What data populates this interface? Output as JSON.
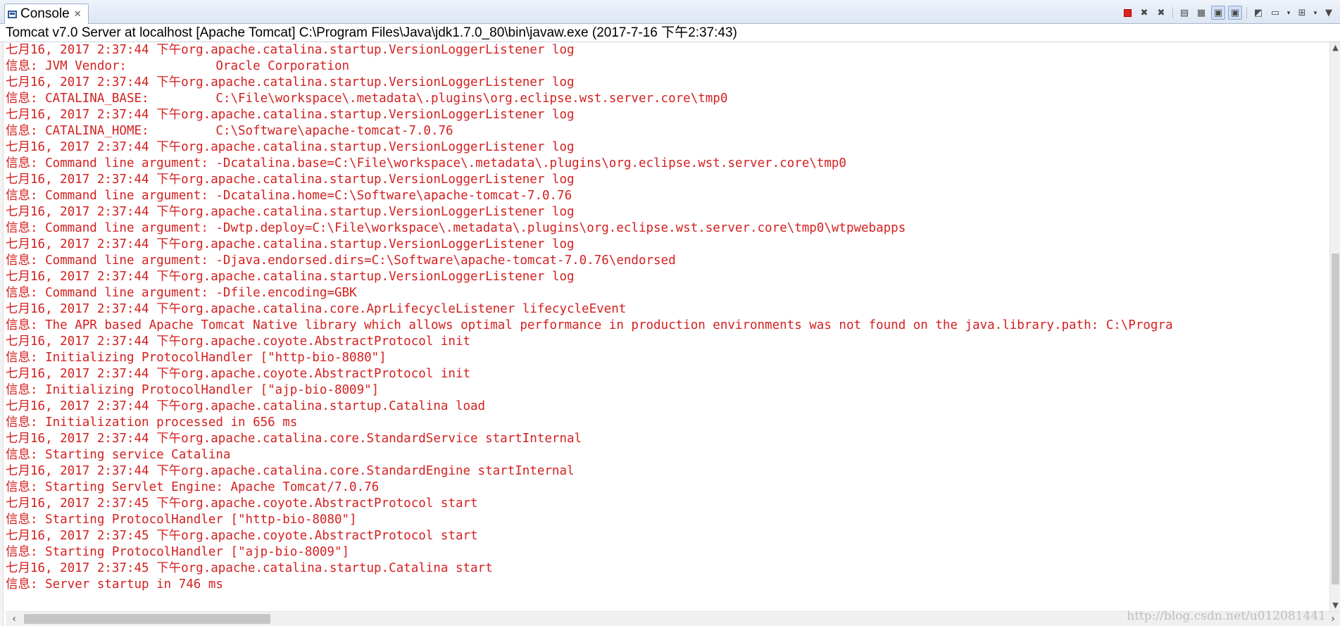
{
  "tab": {
    "title": "Console",
    "close_glyph": "✕"
  },
  "toolbar": {
    "buttons": [
      {
        "name": "terminate-icon"
      },
      {
        "name": "remove-launch-icon"
      },
      {
        "name": "remove-all-terminated-icon"
      },
      {
        "name": "clear-console-icon"
      },
      {
        "name": "scroll-lock-icon"
      },
      {
        "name": "show-stdout-icon"
      },
      {
        "name": "show-stderr-icon"
      },
      {
        "name": "pin-console-icon"
      },
      {
        "name": "display-selected-console-icon"
      },
      {
        "name": "open-console-icon"
      }
    ],
    "dropdown_glyph": "▾"
  },
  "process_label": "Tomcat v7.0 Server at localhost [Apache Tomcat] C:\\Program Files\\Java\\jdk1.7.0_80\\bin\\javaw.exe (2017-7-16 下午2:37:43)",
  "log_lines": [
    "七月16, 2017 2:37:44 下午org.apache.catalina.startup.VersionLoggerListener log",
    "信息: JVM Vendor:            Oracle Corporation",
    "七月16, 2017 2:37:44 下午org.apache.catalina.startup.VersionLoggerListener log",
    "信息: CATALINA_BASE:         C:\\File\\workspace\\.metadata\\.plugins\\org.eclipse.wst.server.core\\tmp0",
    "七月16, 2017 2:37:44 下午org.apache.catalina.startup.VersionLoggerListener log",
    "信息: CATALINA_HOME:         C:\\Software\\apache-tomcat-7.0.76",
    "七月16, 2017 2:37:44 下午org.apache.catalina.startup.VersionLoggerListener log",
    "信息: Command line argument: -Dcatalina.base=C:\\File\\workspace\\.metadata\\.plugins\\org.eclipse.wst.server.core\\tmp0",
    "七月16, 2017 2:37:44 下午org.apache.catalina.startup.VersionLoggerListener log",
    "信息: Command line argument: -Dcatalina.home=C:\\Software\\apache-tomcat-7.0.76",
    "七月16, 2017 2:37:44 下午org.apache.catalina.startup.VersionLoggerListener log",
    "信息: Command line argument: -Dwtp.deploy=C:\\File\\workspace\\.metadata\\.plugins\\org.eclipse.wst.server.core\\tmp0\\wtpwebapps",
    "七月16, 2017 2:37:44 下午org.apache.catalina.startup.VersionLoggerListener log",
    "信息: Command line argument: -Djava.endorsed.dirs=C:\\Software\\apache-tomcat-7.0.76\\endorsed",
    "七月16, 2017 2:37:44 下午org.apache.catalina.startup.VersionLoggerListener log",
    "信息: Command line argument: -Dfile.encoding=GBK",
    "七月16, 2017 2:37:44 下午org.apache.catalina.core.AprLifecycleListener lifecycleEvent",
    "信息: The APR based Apache Tomcat Native library which allows optimal performance in production environments was not found on the java.library.path: C:\\Progra",
    "七月16, 2017 2:37:44 下午org.apache.coyote.AbstractProtocol init",
    "信息: Initializing ProtocolHandler [\"http-bio-8080\"]",
    "七月16, 2017 2:37:44 下午org.apache.coyote.AbstractProtocol init",
    "信息: Initializing ProtocolHandler [\"ajp-bio-8009\"]",
    "七月16, 2017 2:37:44 下午org.apache.catalina.startup.Catalina load",
    "信息: Initialization processed in 656 ms",
    "七月16, 2017 2:37:44 下午org.apache.catalina.core.StandardService startInternal",
    "信息: Starting service Catalina",
    "七月16, 2017 2:37:44 下午org.apache.catalina.core.StandardEngine startInternal",
    "信息: Starting Servlet Engine: Apache Tomcat/7.0.76",
    "七月16, 2017 2:37:45 下午org.apache.coyote.AbstractProtocol start",
    "信息: Starting ProtocolHandler [\"http-bio-8080\"]",
    "七月16, 2017 2:37:45 下午org.apache.coyote.AbstractProtocol start",
    "信息: Starting ProtocolHandler [\"ajp-bio-8009\"]",
    "七月16, 2017 2:37:45 下午org.apache.catalina.startup.Catalina start",
    "信息: Server startup in 746 ms"
  ],
  "colors": {
    "log_text": "#d42020",
    "stop_button": "#e02020"
  },
  "watermark": "http://blog.csdn.net/u012081441"
}
